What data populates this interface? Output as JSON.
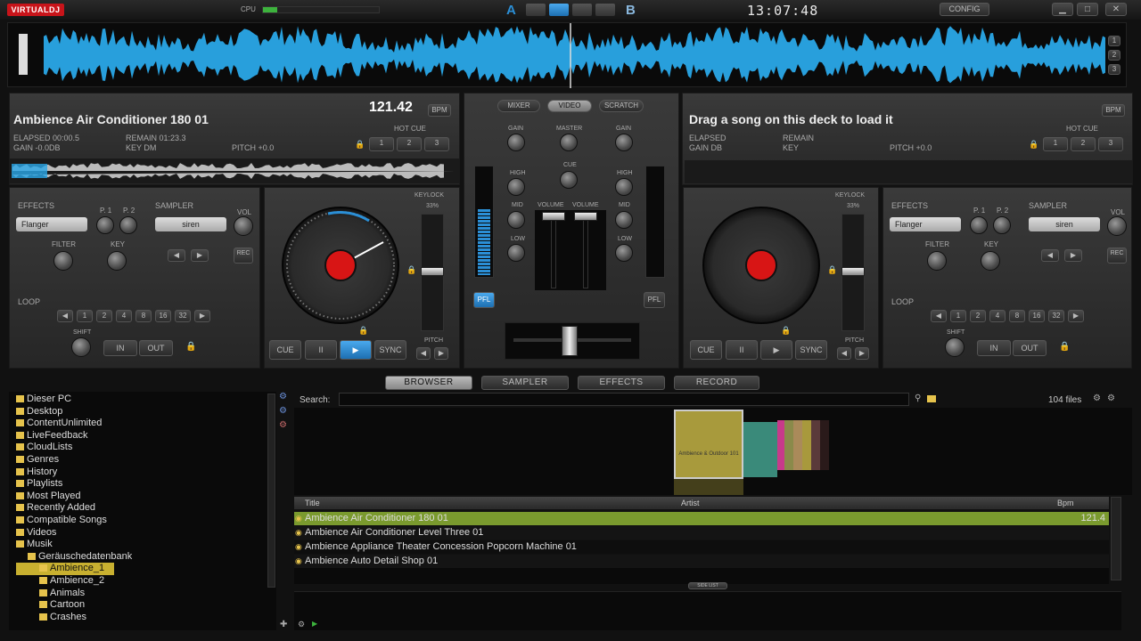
{
  "app": {
    "logo": "VIRTUALDJ",
    "cpu_label": "CPU",
    "clock": "13:07:48",
    "config": "CONFIG",
    "deck_a_letter": "A",
    "deck_b_letter": "B",
    "cpu_load": 0.12
  },
  "window": {
    "minimize": "▁",
    "maximize": "□",
    "close": "✕"
  },
  "zoom_buttons": [
    "1",
    "2",
    "3"
  ],
  "deck_left": {
    "title": "Ambience Air Conditioner 180 01",
    "bpm": "121.42",
    "bpm_label": "BPM",
    "elapsed": "ELAPSED 00:00.5",
    "remain": "REMAIN 01:23.3",
    "gain": "GAIN -0.0dB",
    "key": "KEY Dm",
    "pitch": "PITCH +0.0",
    "hotcue_label": "HOT CUE",
    "hotcues": [
      "1",
      "2",
      "3"
    ],
    "effects_label": "EFFECTS",
    "effect": "Flanger",
    "p1": "P. 1",
    "p2": "P. 2",
    "sampler_label": "SAMPLER",
    "sample": "siren",
    "vol": "VOL",
    "rec": "REC",
    "filter": "FILTER",
    "key_knob": "KEY",
    "loop_label": "LOOP",
    "loops": [
      "1",
      "2",
      "4",
      "8",
      "16",
      "32"
    ],
    "shift": "SHIFT",
    "in": "IN",
    "out": "OUT",
    "keylock": "KEYLOCK",
    "keylock_pct": "33%",
    "cue": "CUE",
    "pause": "II",
    "play": "▶",
    "sync": "SYNC",
    "pitch_label": "PITCH"
  },
  "deck_right": {
    "title": "Drag a song on this deck to load it",
    "bpm_label": "BPM",
    "elapsed": "ELAPSED",
    "remain": "REMAIN",
    "gain": "GAIN dB",
    "key": "KEY",
    "pitch": "PITCH +0.0",
    "hotcue_label": "HOT CUE",
    "hotcues": [
      "1",
      "2",
      "3"
    ],
    "effects_label": "EFFECTS",
    "effect": "Flanger",
    "p1": "P. 1",
    "p2": "P. 2",
    "sampler_label": "SAMPLER",
    "sample": "siren",
    "vol": "VOL",
    "rec": "REC",
    "filter": "FILTER",
    "key_knob": "KEY",
    "loop_label": "LOOP",
    "loops": [
      "1",
      "2",
      "4",
      "8",
      "16",
      "32"
    ],
    "shift": "SHIFT",
    "in": "IN",
    "out": "OUT",
    "keylock": "KEYLOCK",
    "keylock_pct": "33%",
    "cue": "CUE",
    "pause": "II",
    "play": "▶",
    "sync": "SYNC",
    "pitch_label": "PITCH"
  },
  "mixer": {
    "tabs": [
      "MIXER",
      "VIDEO",
      "SCRATCH"
    ],
    "gain": "GAIN",
    "master": "MASTER",
    "cue": "CUE",
    "high": "HIGH",
    "mid": "MID",
    "low": "LOW",
    "volume": "VOLUME",
    "pfl": "PFL"
  },
  "browser_tabs": [
    "BROWSER",
    "SAMPLER",
    "EFFECTS",
    "RECORD"
  ],
  "tree": [
    {
      "label": "Dieser PC",
      "indent": 0
    },
    {
      "label": "Desktop",
      "indent": 0
    },
    {
      "label": "ContentUnlimited",
      "indent": 0
    },
    {
      "label": "LiveFeedback",
      "indent": 0
    },
    {
      "label": "CloudLists",
      "indent": 0
    },
    {
      "label": "Genres",
      "indent": 0
    },
    {
      "label": "History",
      "indent": 0
    },
    {
      "label": "Playlists",
      "indent": 0
    },
    {
      "label": "Most Played",
      "indent": 0
    },
    {
      "label": "Recently Added",
      "indent": 0
    },
    {
      "label": "Compatible Songs",
      "indent": 0
    },
    {
      "label": "Videos",
      "indent": 0
    },
    {
      "label": "Musik",
      "indent": 0
    },
    {
      "label": "Geräuschedatenbank",
      "indent": 1
    },
    {
      "label": "Ambience_1",
      "indent": 2,
      "selected": true
    },
    {
      "label": "Ambience_2",
      "indent": 2
    },
    {
      "label": "Animals",
      "indent": 2
    },
    {
      "label": "Cartoon",
      "indent": 2
    },
    {
      "label": "Crashes",
      "indent": 2
    }
  ],
  "search": {
    "label": "Search:",
    "count": "104 files"
  },
  "cover_caption": "Ambience & Outdoor 101",
  "columns": {
    "title": "Title",
    "artist": "Artist",
    "bpm": "Bpm"
  },
  "tracks": [
    {
      "title": "Ambience Air Conditioner 180 01",
      "artist": "",
      "bpm": "121.4",
      "selected": true
    },
    {
      "title": "Ambience Air Conditioner Level Three 01",
      "artist": "",
      "bpm": ""
    },
    {
      "title": "Ambience Appliance Theater Concession Popcorn Machine 01",
      "artist": "",
      "bpm": ""
    },
    {
      "title": "Ambience Auto Detail Shop 01",
      "artist": "",
      "bpm": ""
    }
  ],
  "side_list": "SIDE LIST",
  "colors": {
    "accent": "#2b8fd6",
    "selected_row": "#7a9a2e",
    "red": "#d81515"
  }
}
